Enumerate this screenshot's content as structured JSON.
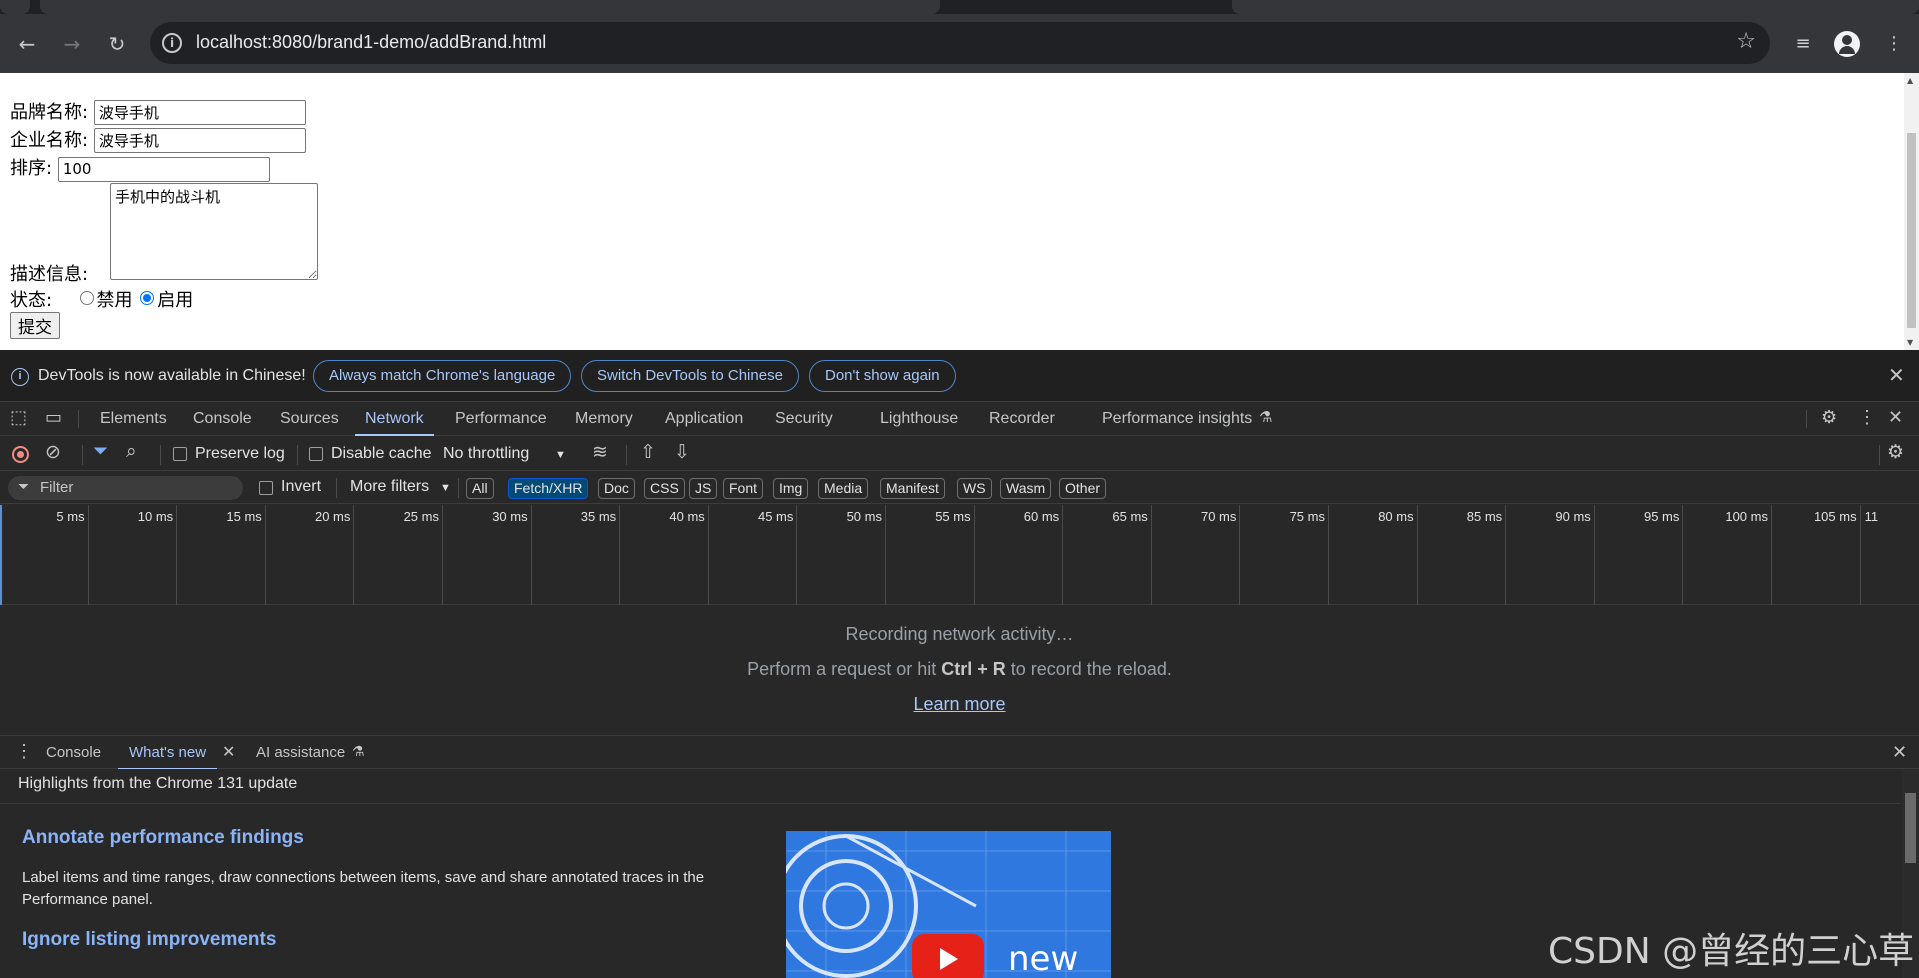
{
  "browser": {
    "url": "localhost:8080/brand1-demo/addBrand.html",
    "back_icon": "arrow-back-icon",
    "forward_icon": "arrow-forward-icon",
    "reload_icon": "reload-icon"
  },
  "form": {
    "brand_label": "品牌名称:",
    "brand_value": "波导手机",
    "company_label": "企业名称:",
    "company_value": "波导手机",
    "order_label": "排序:",
    "order_value": "100",
    "desc_label": "描述信息:",
    "desc_value": "手机中的战斗机",
    "status_label": "状态:",
    "status_disabled": "禁用",
    "status_enabled": "启用",
    "status_selected": "启用",
    "submit_label": "提交"
  },
  "devtools": {
    "infobar": {
      "message": "DevTools is now available in Chinese!",
      "btn_match": "Always match Chrome's language",
      "btn_switch": "Switch DevTools to Chinese",
      "btn_dont": "Don't show again"
    },
    "tabs": [
      "Elements",
      "Console",
      "Sources",
      "Network",
      "Performance",
      "Memory",
      "Application",
      "Security",
      "Lighthouse",
      "Recorder",
      "Performance insights"
    ],
    "active_tab": "Network",
    "controls": {
      "preserve_log": "Preserve log",
      "disable_cache": "Disable cache",
      "throttling": "No throttling"
    },
    "filter": {
      "placeholder": "Filter",
      "invert": "Invert",
      "more_filters": "More filters",
      "chips": [
        "All",
        "Fetch/XHR",
        "Doc",
        "CSS",
        "JS",
        "Font",
        "Img",
        "Media",
        "Manifest",
        "WS",
        "Wasm",
        "Other"
      ],
      "selected_chip": "Fetch/XHR"
    },
    "timeline_ticks": [
      "5 ms",
      "10 ms",
      "15 ms",
      "20 ms",
      "25 ms",
      "30 ms",
      "35 ms",
      "40 ms",
      "45 ms",
      "50 ms",
      "55 ms",
      "60 ms",
      "65 ms",
      "70 ms",
      "75 ms",
      "80 ms",
      "85 ms",
      "90 ms",
      "95 ms",
      "100 ms",
      "105 ms",
      "11"
    ],
    "empty_state": {
      "line1": "Recording network activity…",
      "line2_prefix": "Perform a request or hit ",
      "line2_keys": "Ctrl + R",
      "line2_suffix": " to record the reload.",
      "learn_more": "Learn more"
    },
    "drawer": {
      "tabs": [
        "Console",
        "What's new",
        "AI assistance"
      ],
      "active_tab": "What's new",
      "highlights": "Highlights from the Chrome 131 update",
      "items": [
        {
          "title": "Annotate performance findings",
          "body": "Label items and time ranges, draw connections between items, save and share annotated traces in the Performance panel."
        },
        {
          "title": "Ignore listing improvements",
          "body": ""
        }
      ],
      "video_word": "new"
    }
  },
  "watermark": "CSDN @曾经的三心草"
}
